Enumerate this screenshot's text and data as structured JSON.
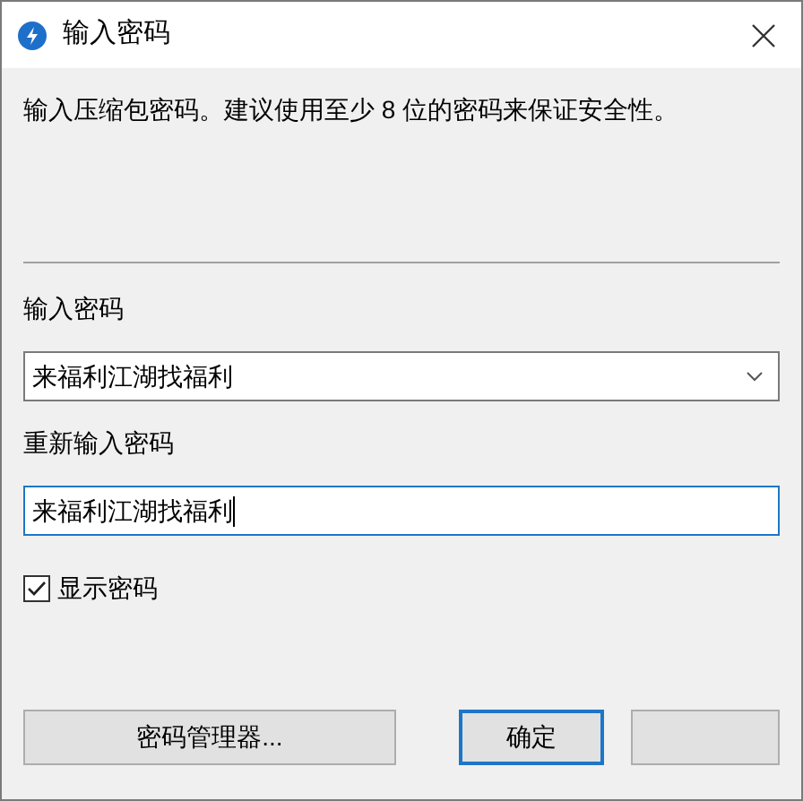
{
  "window": {
    "title": "输入密码"
  },
  "description": "输入压缩包密码。建议使用至少 8 位的密码来保证安全性。",
  "password": {
    "label": "输入密码",
    "value": "来福利江湖找福利"
  },
  "confirm": {
    "label": "重新输入密码",
    "value": "来福利江湖找福利"
  },
  "show_password": {
    "label": "显示密码",
    "checked": true
  },
  "buttons": [
    {
      "label": "密码管理器...",
      "kind": "normal"
    },
    {
      "label": "确定",
      "kind": "default"
    },
    {
      "kind": "hidden-label"
    }
  ]
}
